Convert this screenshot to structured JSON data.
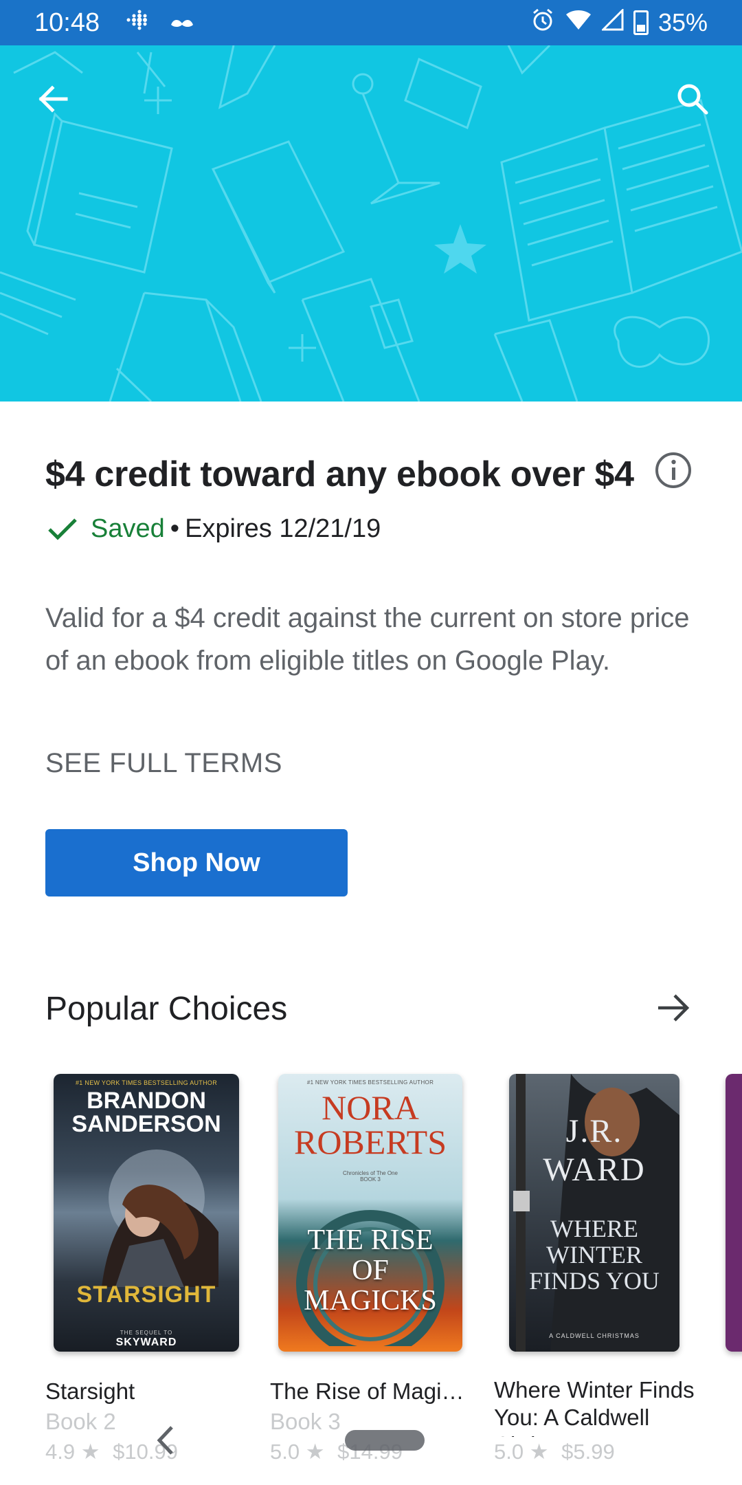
{
  "status_bar": {
    "time": "10:48",
    "battery": "35%"
  },
  "offer": {
    "title": "$4 credit toward any ebook over $4",
    "saved_label": "Saved",
    "separator": "•",
    "expires": "Expires 12/21/19",
    "description": "Valid for a $4 credit against the current on store price of an ebook from eligible titles on Google Play.",
    "terms_label": "SEE FULL TERMS",
    "shop_button": "Shop Now"
  },
  "popular": {
    "title": "Popular Choices",
    "books": [
      {
        "title": "Starsight",
        "subtitle": "Book 2",
        "rating": "4.9",
        "price": "$10.99",
        "cover": {
          "top_line": "#1 NEW YORK TIMES BESTSELLING AUTHOR",
          "author": "BRANDON SANDERSON",
          "name": "STARSIGHT",
          "bottom_line": "THE SEQUEL TO",
          "series": "SKYWARD"
        }
      },
      {
        "title": "The Rise of Magicks",
        "subtitle": "Book 3",
        "rating": "5.0",
        "price": "$14.99",
        "cover": {
          "top_line": "#1 NEW YORK TIMES BESTSELLING AUTHOR",
          "author": "NORA ROBERTS",
          "mid_line": "Chronicles of The One BOOK 3",
          "name": "THE RISE OF MAGICKS"
        }
      },
      {
        "title": "Where Winter Finds You: A Caldwell Christmas",
        "rating": "5.0",
        "price": "$5.99",
        "cover": {
          "author": "J.R. WARD",
          "name": "WHERE WINTER FINDS YOU",
          "bottom_line": "A CALDWELL CHRISTMAS"
        }
      }
    ]
  },
  "colors": {
    "status_bar": "#1a73c8",
    "hero": "#11c6e2",
    "accent": "#1a6fcf",
    "saved": "#188038"
  },
  "icons": {
    "back": "arrow-left-icon",
    "search": "search-icon",
    "info": "info-icon",
    "check": "check-icon",
    "arrow": "arrow-right-icon"
  }
}
